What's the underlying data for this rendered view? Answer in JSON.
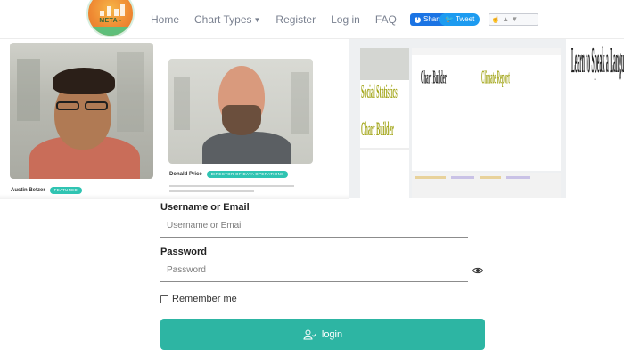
{
  "nav": {
    "logo_text": "META -",
    "items": [
      {
        "label": "Home"
      },
      {
        "label": "Chart Types",
        "has_dropdown": true
      },
      {
        "label": "Register"
      },
      {
        "label": "Log in"
      },
      {
        "label": "FAQ"
      }
    ],
    "share_facebook": "Share",
    "share_twitter": "Tweet"
  },
  "people": [
    {
      "name": "Austin Betzer",
      "badge": "FEATURED"
    },
    {
      "name": "Donald Price",
      "badge": "DIRECTOR OF DATA OPERATIONS"
    }
  ],
  "collage": {
    "text_b1": "Social Statistics",
    "text_b2": "Chart Builder",
    "text_b3": "Climate Report",
    "text_d": "Learn to Speak a Language"
  },
  "form": {
    "username_label": "Username or Email",
    "username_placeholder": "Username or Email",
    "username_value": "",
    "password_label": "Password",
    "password_placeholder": "Password",
    "password_value": "",
    "remember_label": "Remember me",
    "remember_checked": false,
    "login_label": "login"
  },
  "colors": {
    "accent": "#2db5a3",
    "nav_text": "#7a8190",
    "facebook": "#1b74e4",
    "twitter": "#1d9bf0",
    "badge": "#2fc4b2"
  }
}
